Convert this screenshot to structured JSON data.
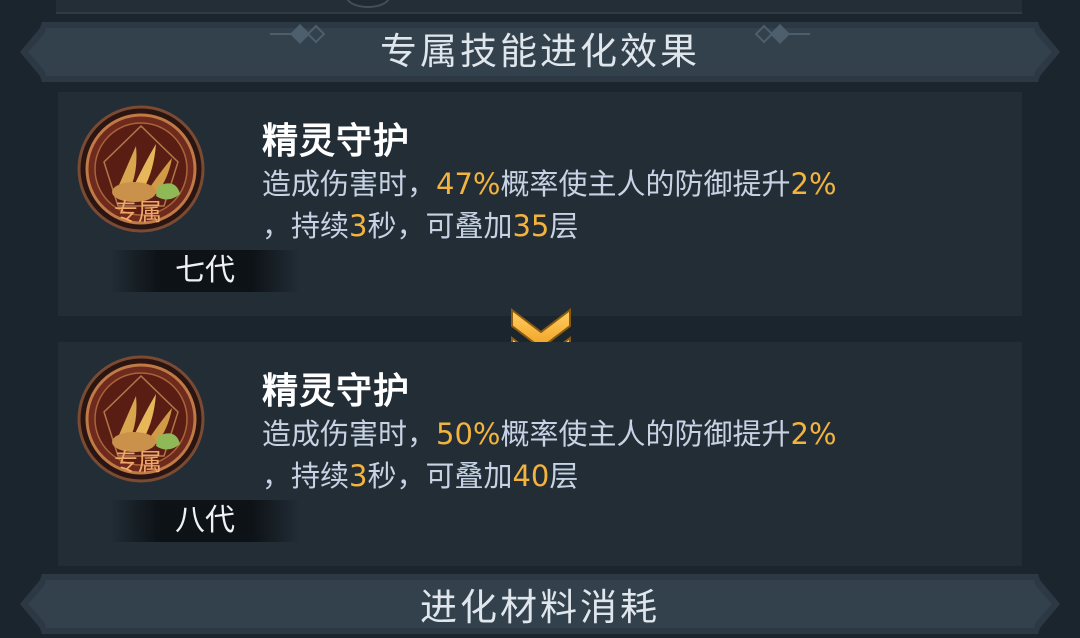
{
  "section_title": "专属技能进化效果",
  "next_section_title": "进化材料消耗",
  "colors": {
    "highlight": "#f3b33d",
    "text": "#c7d3e4",
    "card_bg": "#222d36"
  },
  "icons": {
    "skill": "claw-emblem-icon",
    "arrow": "double-chevron-down-icon"
  },
  "cards": [
    {
      "emblem_label": "专属",
      "generation": "七代",
      "skill_name": "精灵守护",
      "line1": {
        "a": "造成伤害时，",
        "chance": "47%",
        "b": "概率使主人的防御提升",
        "boost": "2%"
      },
      "line2": {
        "a": "，持续",
        "duration": "3",
        "b": "秒，可叠加",
        "stacks": "35",
        "c": "层"
      }
    },
    {
      "emblem_label": "专属",
      "generation": "八代",
      "skill_name": "精灵守护",
      "line1": {
        "a": "造成伤害时，",
        "chance": "50%",
        "b": "概率使主人的防御提升",
        "boost": "2%"
      },
      "line2": {
        "a": "，持续",
        "duration": "3",
        "b": "秒，可叠加",
        "stacks": "40",
        "c": "层"
      }
    }
  ]
}
